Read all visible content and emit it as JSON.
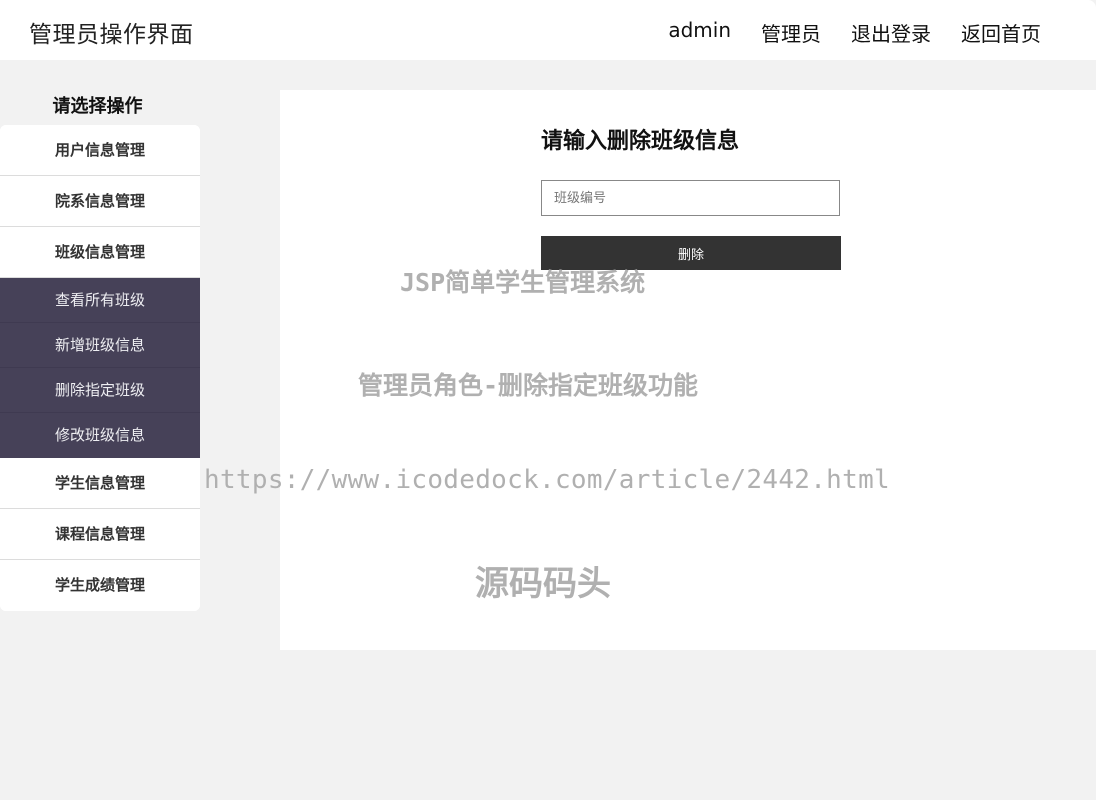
{
  "header": {
    "title": "管理员操作界面",
    "nav": [
      "admin",
      "管理员",
      "退出登录",
      "返回首页"
    ]
  },
  "sidebar": {
    "heading": "请选择操作",
    "items": [
      {
        "label": "用户信息管理"
      },
      {
        "label": "院系信息管理"
      },
      {
        "label": "班级信息管理"
      },
      {
        "label": "学生信息管理"
      },
      {
        "label": "课程信息管理"
      },
      {
        "label": "学生成绩管理"
      }
    ],
    "submenu": [
      {
        "label": "查看所有班级"
      },
      {
        "label": "新增班级信息"
      },
      {
        "label": "删除指定班级"
      },
      {
        "label": "修改班级信息"
      }
    ]
  },
  "form": {
    "title": "请输入删除班级信息",
    "input_placeholder": "班级编号",
    "input_value": "",
    "submit_label": "删除"
  },
  "watermark": {
    "line1": "JSP简单学生管理系统",
    "line2": "管理员角色-删除指定班级功能",
    "line3": "https://www.icodedock.com/article/2442.html",
    "line4": "源码码头"
  },
  "colors": {
    "submenu_bg": "#464158",
    "button_bg": "#333333",
    "page_bg": "#f2f2f2"
  }
}
